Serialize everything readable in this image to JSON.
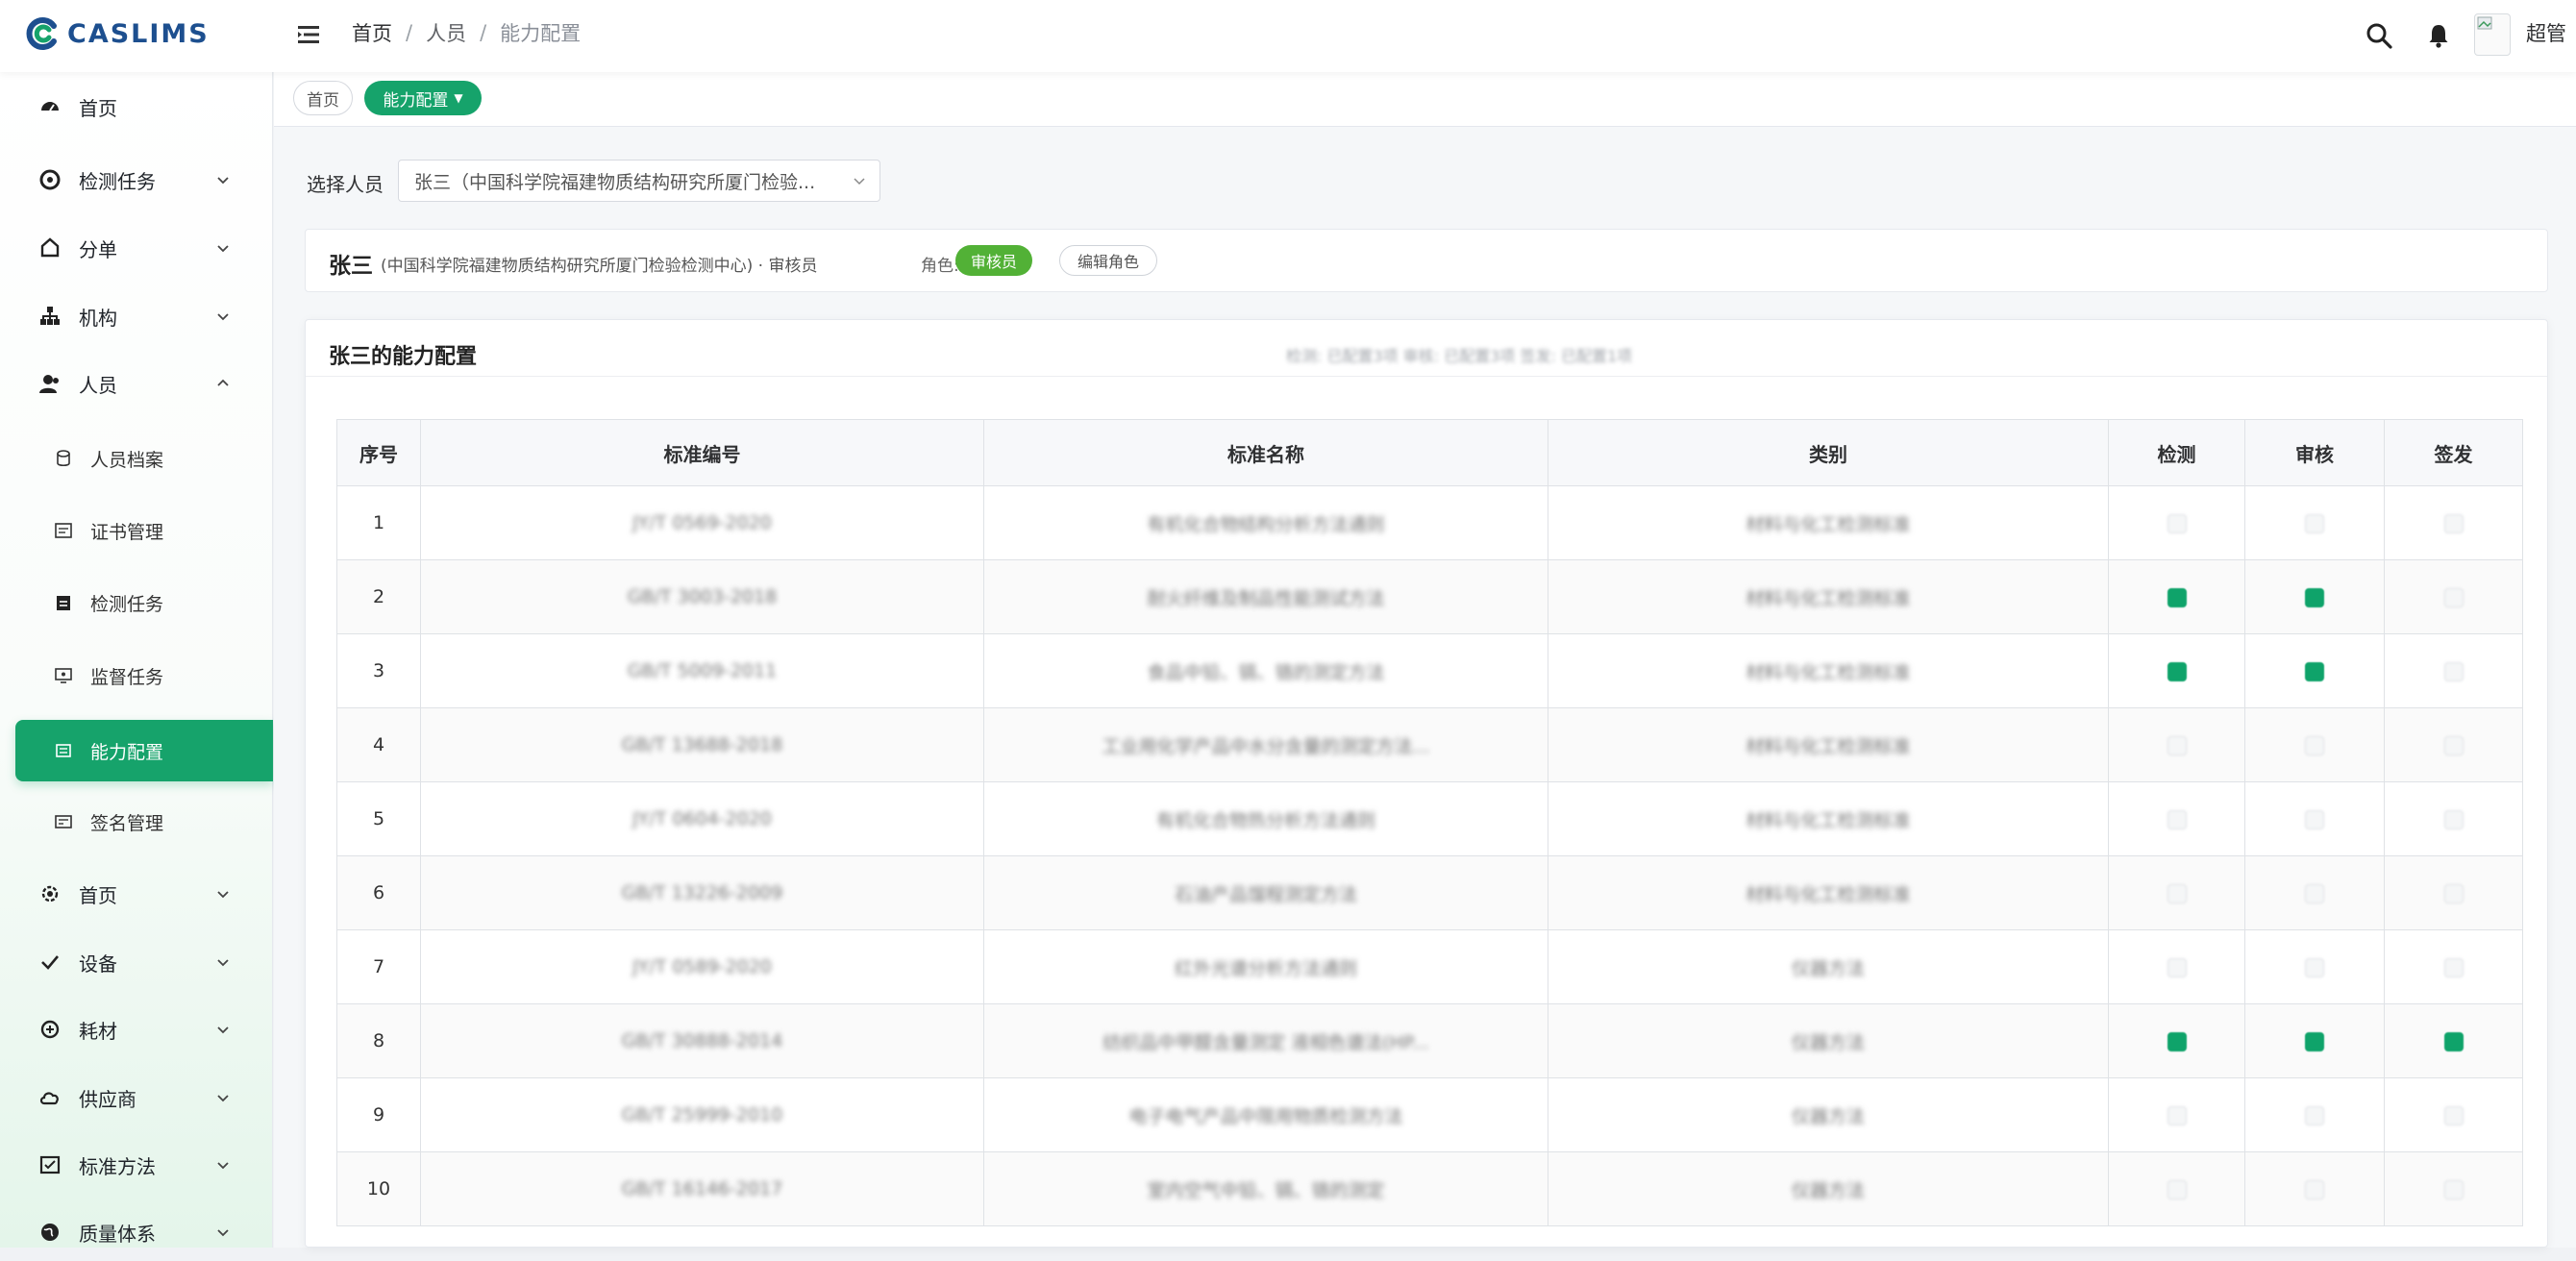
{
  "app": {
    "logo_text": "CASLIMS",
    "user_name": "超管",
    "brand_color": "#16a36b"
  },
  "breadcrumb": [
    "首页",
    "人员",
    "能力配置"
  ],
  "tags": [
    {
      "label": "首页"
    },
    {
      "label": "能力配置"
    }
  ],
  "sidebar": {
    "items": [
      {
        "label": "首页",
        "icon": "dashboard-icon",
        "level": 1,
        "expandable": false
      },
      {
        "label": "检测任务",
        "icon": "task-icon",
        "level": 1,
        "expandable": true
      },
      {
        "label": "分单",
        "icon": "split-icon",
        "level": 1,
        "expandable": true
      },
      {
        "label": "机构",
        "icon": "org-icon",
        "level": 1,
        "expandable": true
      },
      {
        "label": "人员",
        "icon": "user-icon",
        "level": 1,
        "expandable": true,
        "expanded": true
      },
      {
        "label": "人员档案",
        "icon": "archive-icon",
        "level": 2
      },
      {
        "label": "证书管理",
        "icon": "certificate-icon",
        "level": 2
      },
      {
        "label": "检测任务",
        "icon": "clipboard-icon",
        "level": 2
      },
      {
        "label": "监督任务",
        "icon": "monitor-icon",
        "level": 2
      },
      {
        "label": "能力配置",
        "icon": "config-icon",
        "level": 2,
        "active": true
      },
      {
        "label": "签名管理",
        "icon": "signature-icon",
        "level": 2
      },
      {
        "label": "首页",
        "icon": "settings-icon",
        "level": 1,
        "expandable": true
      },
      {
        "label": "设备",
        "icon": "check-icon",
        "level": 1,
        "expandable": true
      },
      {
        "label": "耗材",
        "icon": "material-icon",
        "level": 1,
        "expandable": true
      },
      {
        "label": "供应商",
        "icon": "cloud-icon",
        "level": 1,
        "expandable": true
      },
      {
        "label": "标准方法",
        "icon": "standard-icon",
        "level": 1,
        "expandable": true
      },
      {
        "label": "质量体系",
        "icon": "globe-icon",
        "level": 1,
        "expandable": true
      }
    ]
  },
  "filter": {
    "label": "选择人员",
    "value": "张三（中国科学院福建物质结构研究所厦门检验..."
  },
  "person": {
    "name": "张三",
    "org": "(中国科学院福建物质结构研究所厦门检验检测中心) · 审核员",
    "role_label": "角色:",
    "role": "审核员",
    "edit_label": "编辑角色"
  },
  "panel": {
    "title": "张三的能力配置",
    "hint": "检测: 已配置3项  审核: 已配置3项  签发: 已配置1项"
  },
  "table": {
    "headers": [
      "序号",
      "标准编号",
      "标准名称",
      "类别",
      "检测",
      "审核",
      "签发"
    ],
    "rows": [
      {
        "no": "1",
        "code": "JY/T 0569-2020",
        "name": "有机化合物结构分析方法通则",
        "category": "材料与化工检测标准",
        "detect": false,
        "review": false,
        "issue": false
      },
      {
        "no": "2",
        "code": "GB/T 3003-2018",
        "name": "耐火纤维及制品性能测试方法",
        "category": "材料与化工检测标准",
        "detect": true,
        "review": true,
        "issue": false
      },
      {
        "no": "3",
        "code": "GB/T 5009-2011",
        "name": "食品中铅、镉、铬的测定方法",
        "category": "材料与化工检测标准",
        "detect": true,
        "review": true,
        "issue": false
      },
      {
        "no": "4",
        "code": "GB/T 13688-2018",
        "name": "工业用化学产品中水分含量的测定方法...",
        "category": "材料与化工检测标准",
        "detect": false,
        "review": false,
        "issue": false
      },
      {
        "no": "5",
        "code": "JY/T 0604-2020",
        "name": "有机化合物热分析方法通则",
        "category": "材料与化工检测标准",
        "detect": false,
        "review": false,
        "issue": false
      },
      {
        "no": "6",
        "code": "GB/T 13226-2009",
        "name": "石油产品馏程测定方法",
        "category": "材料与化工检测标准",
        "detect": false,
        "review": false,
        "issue": false
      },
      {
        "no": "7",
        "code": "JY/T 0589-2020",
        "name": "红外光谱分析方法通则",
        "category": "仪器方法",
        "detect": false,
        "review": false,
        "issue": false
      },
      {
        "no": "8",
        "code": "GB/T 30888-2014",
        "name": "纺织品中甲醛含量测定 液相色谱法(HP...",
        "category": "仪器方法",
        "detect": true,
        "review": true,
        "issue": true
      },
      {
        "no": "9",
        "code": "GB/T 25999-2010",
        "name": "电子电气产品中限用物质检测方法",
        "category": "仪器方法",
        "detect": false,
        "review": false,
        "issue": false
      },
      {
        "no": "10",
        "code": "GB/T 16146-2017",
        "name": "室内空气中铅、镉、铬的测定",
        "category": "仪器方法",
        "detect": false,
        "review": false,
        "issue": false
      }
    ]
  }
}
